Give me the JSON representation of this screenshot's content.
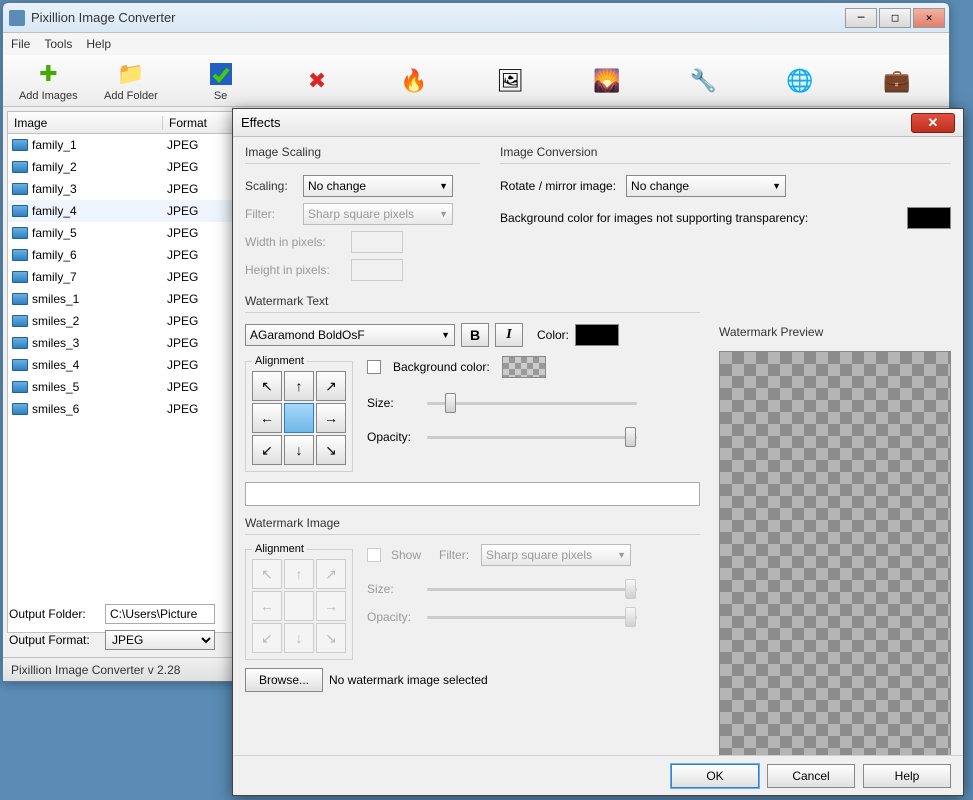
{
  "main": {
    "title": "Pixillion Image Converter",
    "menu": {
      "file": "File",
      "tools": "Tools",
      "help": "Help"
    },
    "toolbar": {
      "add_images": "Add Images",
      "add_folder": "Add Folder",
      "settings_partial": "Se"
    },
    "table": {
      "headers": {
        "image": "Image",
        "format": "Format"
      },
      "rows": [
        {
          "name": "family_1",
          "format": "JPEG"
        },
        {
          "name": "family_2",
          "format": "JPEG"
        },
        {
          "name": "family_3",
          "format": "JPEG"
        },
        {
          "name": "family_4",
          "format": "JPEG",
          "selected": true
        },
        {
          "name": "family_5",
          "format": "JPEG"
        },
        {
          "name": "family_6",
          "format": "JPEG"
        },
        {
          "name": "family_7",
          "format": "JPEG"
        },
        {
          "name": "smiles_1",
          "format": "JPEG"
        },
        {
          "name": "smiles_2",
          "format": "JPEG"
        },
        {
          "name": "smiles_3",
          "format": "JPEG"
        },
        {
          "name": "smiles_4",
          "format": "JPEG"
        },
        {
          "name": "smiles_5",
          "format": "JPEG"
        },
        {
          "name": "smiles_6",
          "format": "JPEG"
        }
      ]
    },
    "output_folder_label": "Output Folder:",
    "output_folder_value": "C:\\Users\\Picture",
    "output_format_label": "Output Format:",
    "output_format_value": "JPEG",
    "status": "Pixillion Image Converter v 2.28"
  },
  "dialog": {
    "title": "Effects",
    "scaling": {
      "title": "Image Scaling",
      "scaling_label": "Scaling:",
      "scaling_value": "No change",
      "filter_label": "Filter:",
      "filter_value": "Sharp square pixels",
      "width_label": "Width in pixels:",
      "height_label": "Height in pixels:"
    },
    "conversion": {
      "title": "Image Conversion",
      "rotate_label": "Rotate / mirror image:",
      "rotate_value": "No change",
      "bg_label": "Background color for images not supporting transparency:"
    },
    "watermark_text": {
      "title": "Watermark Text",
      "font_value": "AGaramond BoldOsF",
      "bold": "B",
      "italic": "I",
      "color_label": "Color:",
      "alignment_label": "Alignment",
      "bg_color_label": "Background color:",
      "size_label": "Size:",
      "opacity_label": "Opacity:"
    },
    "watermark_image": {
      "title": "Watermark Image",
      "alignment_label": "Alignment",
      "show_label": "Show",
      "filter_label": "Filter:",
      "filter_value": "Sharp square pixels",
      "size_label": "Size:",
      "opacity_label": "Opacity:",
      "browse": "Browse...",
      "no_image": "No watermark image selected"
    },
    "preview_title": "Watermark Preview",
    "buttons": {
      "ok": "OK",
      "cancel": "Cancel",
      "help": "Help"
    }
  }
}
